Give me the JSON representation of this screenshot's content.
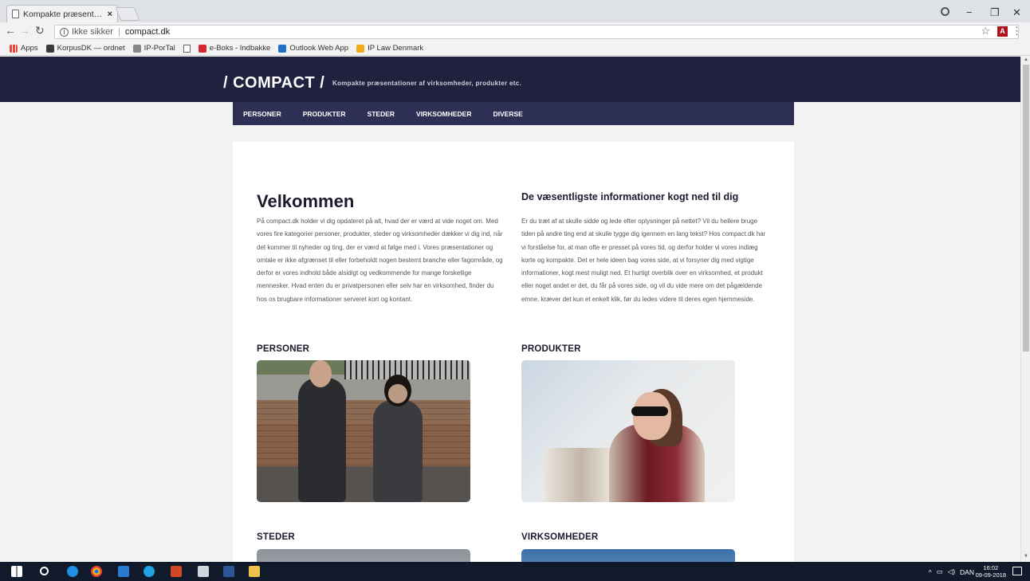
{
  "browser": {
    "tab_title": "Kompakte præsentation",
    "tab_close": "×",
    "security_label": "Ikke sikker",
    "url": "compact.dk",
    "bookmarks": [
      {
        "label": "Apps"
      },
      {
        "label": "KorpusDK — ordnet"
      },
      {
        "label": "IP-PorTal"
      },
      {
        "label": "e-Boks - Indbakke"
      },
      {
        "label": "Outlook Web App"
      },
      {
        "label": "IP Law Denmark"
      }
    ]
  },
  "site": {
    "logo": "/ COMPACT /",
    "tagline": "Kompakte præsentationer af virksomheder, produkter etc.",
    "nav": [
      "PERSONER",
      "PRODUKTER",
      "STEDER",
      "VIRKSOMHEDER",
      "DIVERSE"
    ],
    "welcome_title": "Velkommen",
    "welcome_text": "På compact.dk holder vi dig opdateret på alt, hvad der er værd at vide noget om. Med vores fire kategorier personer, produkter, steder og virksomheder dækker vi dig ind, når det kommer til nyheder og ting, der er værd at følge med i. Vores præsentationer og omtale er ikke afgrænset til eller forbeholdt nogen bestemt branche eller fagområde, og derfor er vores indhold både alsidigt og vedkommende for mange forskellige mennesker. Hvad enten du er privatpersonen eller selv har en virksomhed, finder du hos os brugbare informationer serveret kort og kontant.",
    "info_title": "De væsentligste informationer kogt ned til dig",
    "info_text": "Er du træt af at skulle sidde og lede efter oplysninger på nettet? Vil du hellere bruge tiden på andre ting end at skulle tygge dig igennem en lang tekst? Hos compact.dk har vi forståelse for, at man ofte er presset på vores tid, og derfor holder vi vores indlæg korte og kompakte. Det er hele ideen bag vores side, at vi forsyner dig med vigtige informationer, kogt mest muligt ned. Et hurtigt overblik over en virksomhed, et produkt eller noget andet er det, du får på vores side, og vil du vide mere om det pågældende emne, kræver det kun et enkelt klik, før du ledes videre til deres egen hjemmeside.",
    "sections": {
      "personer": "PERSONER",
      "produkter": "PRODUKTER",
      "steder": "STEDER",
      "virksomheder": "VIRKSOMHEDER"
    }
  },
  "taskbar": {
    "language": "DAN",
    "time": "16:02",
    "date": "09-09-2018"
  },
  "colors": {
    "header_bg": "#20213e",
    "nav_bg": "#2e2f55"
  }
}
